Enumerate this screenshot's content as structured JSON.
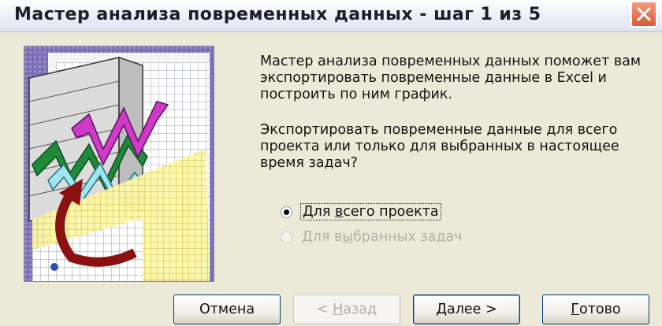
{
  "window": {
    "title": "Мастер анализа повременных данных - шаг 1 из 5"
  },
  "description": {
    "paragraph1": "Мастер анализа повременных данных поможет вам экспортировать повременные данные в Excel и построить по ним график.",
    "paragraph2": "Экспортировать повременные данные для всего проекта или только для выбранных в настоящее время задач?"
  },
  "options": [
    {
      "label_pre": "Для ",
      "label_key": "в",
      "label_post": "сего проекта",
      "selected": true,
      "enabled": true
    },
    {
      "label_pre": "Для в",
      "label_key": "ы",
      "label_post": "бранных задач",
      "selected": false,
      "enabled": false
    }
  ],
  "buttons": {
    "cancel": {
      "label": "Отмена",
      "enabled": true
    },
    "back": {
      "prefix": "< ",
      "key": "Н",
      "rest": "азад",
      "enabled": false
    },
    "next": {
      "key": "Д",
      "rest": "алее >",
      "enabled": true
    },
    "finish": {
      "key": "Г",
      "rest": "отово",
      "enabled": true
    }
  },
  "colors": {
    "close_button": "#d65a38",
    "accent_border": "#003c74"
  }
}
